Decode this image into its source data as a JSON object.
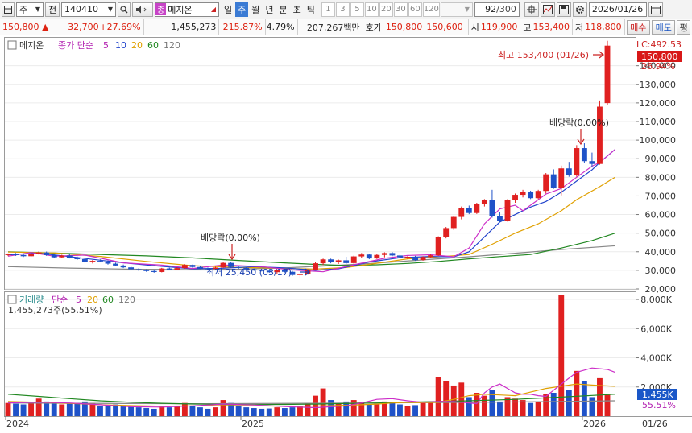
{
  "toolbar": {
    "market": "주",
    "prev": "전",
    "code": "140410",
    "stock_name": "메지온",
    "stock_tag": "종",
    "periods": [
      "일",
      "주",
      "월",
      "년",
      "분",
      "초",
      "틱"
    ],
    "active_period": "주",
    "intervals": [
      "1",
      "3",
      "5",
      "10",
      "20",
      "30",
      "60",
      "120"
    ],
    "count": "92",
    "count_total": "/300",
    "date": "2026/01/26"
  },
  "quote": {
    "price": "150,800",
    "arrow": "▲",
    "change": "32,700",
    "change_pct": "+27.69%",
    "volume": "1,455,273",
    "vol_pct": "215.87%",
    "turnover": "4.79%",
    "amount": "207,267백만",
    "hoga_label": "호가",
    "ask": "150,800",
    "bid": "150,600",
    "open_label": "시",
    "open": "119,900",
    "high_label": "고",
    "high": "153,400",
    "low_label": "저",
    "low": "118,800",
    "buy": "매수",
    "sell": "매도",
    "flat": "평"
  },
  "price_pane": {
    "name": "메지온",
    "legend_label": "종가 단순",
    "ma": [
      "5",
      "10",
      "20",
      "60",
      "120"
    ],
    "ma_colors": [
      "#cc2ec8",
      "#2244cc",
      "#e0a000",
      "#228822",
      "#888888"
    ],
    "lc": "LC:492.53",
    "current": "150,800",
    "current_pct": "26.94%",
    "high_annot": "최고 153,400 (01/26)",
    "low_annot": "최저 25,450 (03/17)",
    "div1": "배당락(0.00%)",
    "div2": "배당락(0.00%)"
  },
  "volume_pane": {
    "title": "거래량",
    "legend_label": "단순",
    "ma": [
      "5",
      "20",
      "60",
      "120"
    ],
    "ma_colors": [
      "#cc2ec8",
      "#e0a000",
      "#228822",
      "#888888"
    ],
    "current_text": "1,455,273주(55.51%)",
    "current_label": "1,455K",
    "pct_label": "55.51%"
  },
  "x_axis": {
    "labels": [
      "2024",
      "2025",
      "2026"
    ],
    "right_label": "01/26"
  },
  "chart_data": {
    "type": "candlestick",
    "y_ticks": [
      20000,
      30000,
      40000,
      50000,
      60000,
      70000,
      80000,
      90000,
      100000,
      110000,
      120000,
      130000,
      140000
    ],
    "y_tick_labels": [
      "20,000",
      "30,000",
      "40,000",
      "50,000",
      "60,000",
      "70,000",
      "80,000",
      "90,000",
      "100,000",
      "110,000",
      "120,000",
      "130,000",
      "140,000"
    ],
    "vol_ticks": [
      2000,
      4000,
      6000,
      8000
    ],
    "vol_tick_labels": [
      "2,000K",
      "4,000K",
      "6,000K",
      "8,000K"
    ],
    "y_range": [
      20000,
      155000
    ],
    "vol_range": [
      0,
      8500
    ],
    "candles": [
      [
        38200,
        39100,
        37700,
        38800,
        900
      ],
      [
        38800,
        39300,
        37800,
        38200,
        850
      ],
      [
        38200,
        38900,
        37200,
        37600,
        800
      ],
      [
        37600,
        39300,
        37400,
        39000,
        950
      ],
      [
        39000,
        40200,
        38500,
        39600,
        1200
      ],
      [
        39600,
        40100,
        37800,
        38200,
        1000
      ],
      [
        38200,
        38600,
        36600,
        37000,
        900
      ],
      [
        37000,
        38400,
        36800,
        38000,
        800
      ],
      [
        38000,
        38800,
        36400,
        36800,
        850
      ],
      [
        36800,
        37400,
        35600,
        36000,
        900
      ],
      [
        36000,
        36600,
        34200,
        34700,
        1000
      ],
      [
        34700,
        35600,
        33700,
        35100,
        900
      ],
      [
        35100,
        35900,
        34300,
        34700,
        700
      ],
      [
        34700,
        35300,
        33100,
        33600,
        750
      ],
      [
        33600,
        34100,
        32200,
        32600,
        800
      ],
      [
        32600,
        33100,
        31200,
        31600,
        700
      ],
      [
        31600,
        32100,
        30200,
        30600,
        650
      ],
      [
        30600,
        31100,
        29700,
        30100,
        600
      ],
      [
        30100,
        30600,
        29200,
        29600,
        550
      ],
      [
        29600,
        30300,
        28700,
        29100,
        500
      ],
      [
        29100,
        31300,
        28900,
        31000,
        700
      ],
      [
        31000,
        31400,
        30000,
        30400,
        600
      ],
      [
        30400,
        31600,
        30100,
        31200,
        650
      ],
      [
        31200,
        33300,
        30900,
        32900,
        900
      ],
      [
        32900,
        33100,
        31400,
        31800,
        700
      ],
      [
        31800,
        32200,
        30600,
        31000,
        600
      ],
      [
        31000,
        31500,
        30200,
        30700,
        500
      ],
      [
        30700,
        31900,
        30400,
        31500,
        600
      ],
      [
        31500,
        34300,
        31300,
        34000,
        1100
      ],
      [
        34000,
        34400,
        31400,
        31800,
        900
      ],
      [
        31800,
        32400,
        30800,
        31300,
        700
      ],
      [
        31300,
        31700,
        30100,
        30500,
        600
      ],
      [
        30500,
        31000,
        29700,
        30100,
        550
      ],
      [
        30100,
        30600,
        29400,
        29800,
        500
      ],
      [
        29800,
        30300,
        28700,
        29000,
        520
      ],
      [
        29000,
        30600,
        28200,
        30100,
        600
      ],
      [
        30100,
        30500,
        28800,
        29200,
        550
      ],
      [
        29200,
        29700,
        27000,
        27500,
        600
      ],
      [
        27500,
        28300,
        25450,
        27900,
        700
      ],
      [
        27900,
        30600,
        27700,
        30300,
        900
      ],
      [
        30300,
        34300,
        30000,
        33800,
        1400
      ],
      [
        33800,
        36300,
        32800,
        35900,
        1900
      ],
      [
        35900,
        36300,
        33800,
        34300,
        1100
      ],
      [
        34300,
        35800,
        33400,
        35400,
        900
      ],
      [
        35400,
        37300,
        33400,
        33900,
        1000
      ],
      [
        33900,
        37900,
        33600,
        37500,
        1100
      ],
      [
        37500,
        39300,
        36600,
        38500,
        950
      ],
      [
        38500,
        39000,
        36000,
        36400,
        800
      ],
      [
        36400,
        38800,
        36100,
        38300,
        850
      ],
      [
        38300,
        39700,
        37000,
        39300,
        1000
      ],
      [
        39300,
        39800,
        37600,
        38000,
        900
      ],
      [
        38000,
        38600,
        36600,
        37000,
        800
      ],
      [
        37000,
        37700,
        36100,
        37300,
        700
      ],
      [
        37300,
        37800,
        35100,
        35500,
        750
      ],
      [
        35500,
        37600,
        35200,
        37200,
        900
      ],
      [
        37200,
        38600,
        36800,
        38100,
        1000
      ],
      [
        38100,
        48300,
        37800,
        48000,
        2700
      ],
      [
        48000,
        53300,
        47200,
        52700,
        2400
      ],
      [
        52700,
        59300,
        51700,
        58700,
        2100
      ],
      [
        58700,
        64300,
        57400,
        63700,
        2300
      ],
      [
        63700,
        64800,
        60200,
        60800,
        1300
      ],
      [
        60800,
        66300,
        60300,
        65700,
        1600
      ],
      [
        65700,
        68300,
        64300,
        67600,
        1400
      ],
      [
        67600,
        73300,
        58300,
        59200,
        1800
      ],
      [
        59200,
        61300,
        55800,
        56700,
        1000
      ],
      [
        56700,
        68300,
        56200,
        67700,
        1300
      ],
      [
        67700,
        71300,
        66300,
        70600,
        1200
      ],
      [
        70600,
        73300,
        69200,
        72100,
        1100
      ],
      [
        72100,
        72800,
        68300,
        68800,
        900
      ],
      [
        68800,
        73300,
        68300,
        72700,
        1000
      ],
      [
        72700,
        82300,
        71300,
        81600,
        1500
      ],
      [
        81600,
        84300,
        73800,
        74200,
        1600
      ],
      [
        74200,
        86300,
        70300,
        84800,
        8300
      ],
      [
        84800,
        88300,
        80300,
        81200,
        1800
      ],
      [
        81200,
        97300,
        80300,
        95700,
        3100
      ],
      [
        95700,
        98300,
        87800,
        88700,
        2400
      ],
      [
        88700,
        93300,
        85300,
        87200,
        1300
      ],
      [
        87200,
        121300,
        86800,
        118000,
        2600
      ],
      [
        119900,
        153400,
        118800,
        150800,
        1455
      ]
    ],
    "ma": {
      "5": [
        [
          37600,
          39600,
          37600,
          38200,
          34000,
          32800,
          31000,
          32900,
          32000,
          30200,
          29200,
          33000,
          36500,
          38000,
          38400,
          37300,
          42000,
          55000,
          63000,
          65000,
          62000,
          68000,
          71000,
          74000,
          80000,
          86000,
          88000,
          95000
        ],
        [
          0,
          3,
          6,
          10,
          15,
          20,
          24,
          28,
          33,
          37,
          41,
          45,
          49,
          52,
          55,
          58,
          60,
          62,
          64,
          66,
          67,
          69,
          70,
          72,
          74,
          76,
          77,
          79
        ]
      ],
      "10": [
        [
          38300,
          39200,
          37400,
          34500,
          32500,
          30800,
          31100,
          32000,
          31300,
          30000,
          30800,
          34500,
          36800,
          37500,
          37200,
          40000,
          48000,
          56000,
          60000,
          64000,
          67000,
          72000,
          78000,
          84000,
          88000,
          95000
        ],
        [
          0,
          4,
          8,
          14,
          19,
          24,
          28,
          32,
          36,
          40,
          43,
          47,
          51,
          55,
          58,
          60,
          62,
          64,
          66,
          68,
          70,
          72,
          74,
          76,
          77,
          79
        ]
      ],
      "20": [
        [
          39800,
          39400,
          37500,
          34800,
          32500,
          31500,
          31300,
          30800,
          30700,
          31500,
          33800,
          36200,
          37200,
          38500,
          44000,
          50000,
          55000,
          62000,
          68000,
          75000,
          80000
        ],
        [
          0,
          6,
          12,
          18,
          24,
          30,
          34,
          38,
          40,
          44,
          48,
          52,
          56,
          60,
          63,
          66,
          69,
          72,
          74,
          77,
          79
        ]
      ],
      "60": [
        [
          40000,
          39300,
          38500,
          37800,
          36700,
          35300,
          34000,
          33200,
          32600,
          33000,
          33700,
          34800,
          36200,
          37400,
          38500,
          42000,
          46000,
          50000
        ],
        [
          0,
          6,
          12,
          18,
          24,
          30,
          36,
          40,
          44,
          48,
          52,
          56,
          60,
          64,
          68,
          72,
          76,
          79
        ]
      ],
      "120": [
        [
          32000,
          31200,
          30600,
          30400,
          30600,
          31300,
          32500,
          33900,
          35600,
          37300,
          39200,
          41200,
          43200
        ],
        [
          0,
          8,
          16,
          24,
          30,
          36,
          42,
          48,
          54,
          60,
          66,
          72,
          79
        ]
      ]
    },
    "vol_ma": {
      "5": [
        [
          900,
          950,
          900,
          780,
          640,
          620,
          700,
          820,
          760,
          650,
          580,
          700,
          900,
          1150,
          1200,
          1050,
          950,
          1000,
          1000,
          900,
          850,
          1600,
          2000,
          2200,
          1900,
          1600,
          1500,
          1500,
          1400,
          1350,
          2200,
          3000,
          3300,
          3200,
          3000
        ],
        [
          0,
          4,
          8,
          12,
          16,
          20,
          24,
          28,
          32,
          36,
          40,
          44,
          46,
          48,
          50,
          52,
          54,
          56,
          58,
          60,
          61,
          62,
          63,
          64,
          65,
          66,
          67,
          68,
          69,
          70,
          72,
          74,
          76,
          78,
          79
        ]
      ],
      "20": [
        [
          1000,
          950,
          870,
          780,
          720,
          680,
          700,
          720,
          700,
          680,
          690,
          740,
          820,
          900,
          940,
          920,
          950,
          1150,
          1400,
          1500,
          1450,
          1400,
          1900,
          2200,
          2100,
          2050
        ],
        [
          0,
          4,
          8,
          12,
          16,
          20,
          24,
          28,
          32,
          36,
          40,
          44,
          48,
          50,
          52,
          54,
          56,
          58,
          60,
          62,
          64,
          66,
          70,
          74,
          77,
          79
        ]
      ],
      "60": [
        [
          1500,
          1350,
          1200,
          1050,
          950,
          880,
          830,
          800,
          790,
          800,
          820,
          860,
          900,
          950,
          1000,
          1050,
          1150,
          1300,
          1500
        ],
        [
          0,
          4,
          8,
          12,
          16,
          20,
          24,
          28,
          32,
          36,
          40,
          44,
          48,
          52,
          56,
          60,
          66,
          72,
          79
        ]
      ],
      "120": [
        [
          900,
          880,
          860,
          850,
          860,
          880,
          900,
          930,
          960,
          1000,
          1050
        ],
        [
          0,
          8,
          16,
          24,
          32,
          40,
          48,
          56,
          64,
          72,
          79
        ]
      ]
    }
  }
}
